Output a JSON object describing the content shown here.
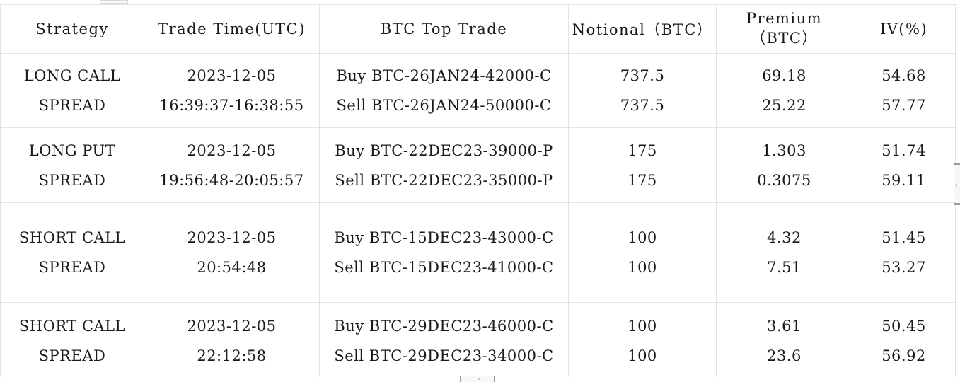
{
  "table": {
    "columns": [
      {
        "key": "strategy",
        "label": "Strategy"
      },
      {
        "key": "trade_time",
        "label": "Trade Time(UTC)"
      },
      {
        "key": "top_trade",
        "label": "BTC Top Trade"
      },
      {
        "key": "notional",
        "label": "Notional（BTC）"
      },
      {
        "key": "premium",
        "label": "Premium（BTC）"
      },
      {
        "key": "iv",
        "label": "IV(%)"
      }
    ],
    "rows": [
      {
        "strategy": [
          "LONG CALL",
          "SPREAD"
        ],
        "trade_time": [
          "2023-12-05",
          "16:39:37-16:38:55"
        ],
        "top_trade": [
          "Buy BTC-26JAN24-42000-C",
          "Sell BTC-26JAN24-50000-C"
        ],
        "notional": [
          "737.5",
          "737.5"
        ],
        "premium": [
          "69.18",
          "25.22"
        ],
        "iv": [
          "54.68",
          "57.77"
        ]
      },
      {
        "strategy": [
          "LONG PUT",
          "SPREAD"
        ],
        "trade_time": [
          "2023-12-05",
          "19:56:48-20:05:57"
        ],
        "top_trade": [
          "Buy BTC-22DEC23-39000-P",
          "Sell BTC-22DEC23-35000-P"
        ],
        "notional": [
          "175",
          "175"
        ],
        "premium": [
          "1.303",
          "0.3075"
        ],
        "iv": [
          "51.74",
          "59.11"
        ]
      },
      {
        "strategy": [
          "SHORT CALL",
          "SPREAD"
        ],
        "trade_time": [
          "2023-12-05",
          "20:54:48"
        ],
        "top_trade": [
          "Buy BTC-15DEC23-43000-C",
          "Sell BTC-15DEC23-41000-C"
        ],
        "notional": [
          "100",
          "100"
        ],
        "premium": [
          "4.32",
          "7.51"
        ],
        "iv": [
          "51.45",
          "53.27"
        ]
      },
      {
        "strategy": [
          "SHORT CALL",
          "SPREAD"
        ],
        "trade_time": [
          "2023-12-05",
          "22:12:58"
        ],
        "top_trade": [
          "Buy BTC-29DEC23-46000-C",
          "Sell BTC-29DEC23-34000-C"
        ],
        "notional": [
          "100",
          "100"
        ],
        "premium": [
          "3.61",
          "23.6"
        ],
        "iv": [
          "50.45",
          "56.92"
        ]
      }
    ]
  },
  "colors": {
    "border": "#e3e3e3",
    "text": "#1a1a1a",
    "background": "#ffffff",
    "scrollbar_thumb": "#f7f7f7",
    "scrollbar_edge": "#9a9a9a"
  }
}
